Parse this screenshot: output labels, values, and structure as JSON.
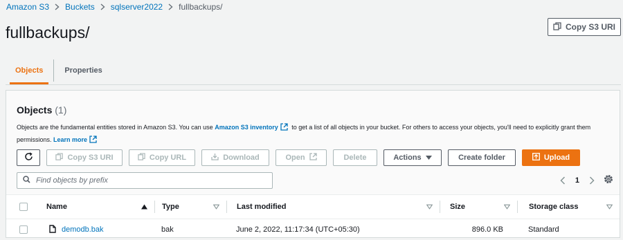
{
  "breadcrumb": {
    "items": [
      {
        "label": "Amazon S3"
      },
      {
        "label": "Buckets"
      },
      {
        "label": "sqlserver2022"
      }
    ],
    "current": "fullbackups/"
  },
  "page": {
    "title": "fullbackups/",
    "copy_uri_label": "Copy S3 URI"
  },
  "tabs": [
    {
      "label": "Objects",
      "active": true
    },
    {
      "label": "Properties",
      "active": false
    }
  ],
  "objects_panel": {
    "title": "Objects",
    "count": "(1)",
    "description_part1": "Objects are the fundamental entities stored in Amazon S3. You can use",
    "inventory_link": "Amazon S3 inventory",
    "description_part2": "to get a list of all objects in your bucket. For others to access your objects, you'll need to explicitly grant them permissions.",
    "learn_more": "Learn more"
  },
  "toolbar": {
    "copy_uri": "Copy S3 URI",
    "copy_url": "Copy URL",
    "download": "Download",
    "open": "Open",
    "delete": "Delete",
    "actions": "Actions",
    "create_folder": "Create folder",
    "upload": "Upload"
  },
  "search": {
    "placeholder": "Find objects by prefix",
    "value": ""
  },
  "pagination": {
    "page": "1"
  },
  "table": {
    "columns": {
      "name": "Name",
      "type": "Type",
      "last_modified": "Last modified",
      "size": "Size",
      "storage_class": "Storage class"
    },
    "rows": [
      {
        "name": "demodb.bak",
        "type": "bak",
        "last_modified": "June 2, 2022, 11:17:34 (UTC+05:30)",
        "size": "896.0 KB",
        "storage_class": "Standard"
      }
    ]
  },
  "colors": {
    "accent": "#ec7211",
    "link": "#0073bb",
    "text": "#16191f",
    "muted": "#aab7b8"
  },
  "icons": {
    "chevron": "chevron-right-icon",
    "copy": "copy-icon",
    "refresh": "refresh-icon",
    "download": "download-icon",
    "external": "external-link-icon",
    "caret": "caret-down-icon",
    "upload": "upload-icon",
    "search": "search-icon",
    "settings": "gear-icon",
    "file": "file-icon"
  }
}
